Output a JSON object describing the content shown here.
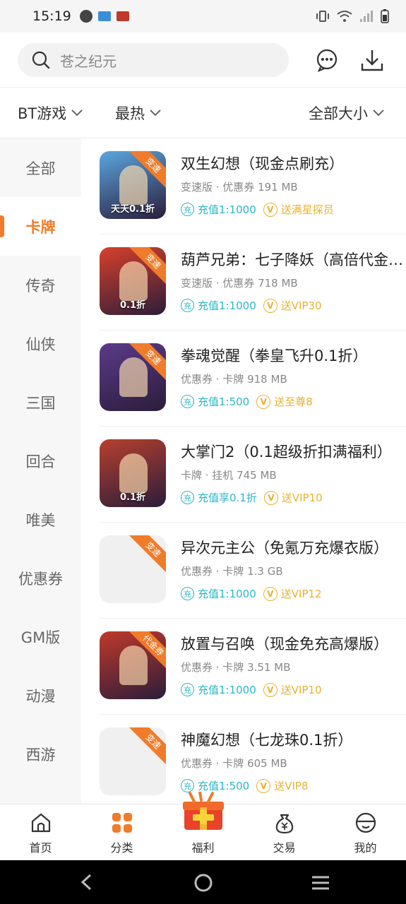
{
  "status_bar": {
    "time": "15:19"
  },
  "search": {
    "placeholder": "苍之纪元"
  },
  "filters": {
    "category": "BT游戏",
    "sort": "最热",
    "size": "全部大小"
  },
  "sidebar": {
    "items": [
      {
        "label": "全部",
        "active": false
      },
      {
        "label": "卡牌",
        "active": true
      },
      {
        "label": "传奇",
        "active": false
      },
      {
        "label": "仙侠",
        "active": false
      },
      {
        "label": "三国",
        "active": false
      },
      {
        "label": "回合",
        "active": false
      },
      {
        "label": "唯美",
        "active": false
      },
      {
        "label": "优惠券",
        "active": false
      },
      {
        "label": "GM版",
        "active": false
      },
      {
        "label": "动漫",
        "active": false
      },
      {
        "label": "西游",
        "active": false
      }
    ]
  },
  "games": [
    {
      "title": "双生幻想（现金点刷充）",
      "meta": "变速版 · 优惠券  191 MB",
      "recharge": "充值1:1000",
      "gift": "送满星探员",
      "ribbon": "变速",
      "thumb": "art",
      "thumb_text": "天天0.1折",
      "thumb_color": "#5aa7e0"
    },
    {
      "title": "葫芦兄弟：七子降妖（高倍代金券版）",
      "meta": "变速版 · 优惠券  718 MB",
      "recharge": "充值1:1000",
      "gift": "送VIP30",
      "ribbon": "变速",
      "thumb": "art",
      "thumb_text": "0.1折",
      "thumb_color": "#d8402b"
    },
    {
      "title": "拳魂觉醒（拳皇飞升0.1折）",
      "meta": "优惠券 · 卡牌  918 MB",
      "recharge": "充值1:500",
      "gift": "送至尊8",
      "ribbon": "变速",
      "thumb": "art",
      "thumb_text": "",
      "thumb_color": "#5b3a8a"
    },
    {
      "title": "大掌门2（0.1超级折扣满福利）",
      "meta": "卡牌 · 挂机  745 MB",
      "recharge": "充值享0.1折",
      "gift": "送VIP10",
      "ribbon": "",
      "thumb": "art",
      "thumb_text": "0.1折",
      "thumb_color": "#b7402e"
    },
    {
      "title": "异次元主公（免氪万充爆衣版）",
      "meta": "优惠券 · 卡牌  1.3 GB",
      "recharge": "充值1:1000",
      "gift": "送VIP12",
      "ribbon": "变速",
      "thumb": "blank",
      "thumb_text": "",
      "thumb_color": "#f0f0f0"
    },
    {
      "title": "放置与召唤（现金免充高爆版）",
      "meta": "优惠券 · 卡牌  3.51 MB",
      "recharge": "充值1:1000",
      "gift": "送VIP10",
      "ribbon": "代金券",
      "thumb": "art",
      "thumb_text": "",
      "thumb_color": "#c0392b"
    },
    {
      "title": "神魔幻想（七龙珠0.1折）",
      "meta": "优惠券 · 卡牌  605 MB",
      "recharge": "充值1:500",
      "gift": "送VIP8",
      "ribbon": "变速",
      "thumb": "blank",
      "thumb_text": "",
      "thumb_color": "#f0f0f0"
    }
  ],
  "tag_icons": {
    "recharge": "充",
    "gift": "V"
  },
  "bottom_nav": {
    "items": [
      {
        "label": "首页",
        "icon": "home-icon"
      },
      {
        "label": "分类",
        "icon": "category-icon",
        "active": true
      },
      {
        "label": "福利",
        "icon": "gift-box-icon"
      },
      {
        "label": "交易",
        "icon": "money-bag-icon"
      },
      {
        "label": "我的",
        "icon": "profile-icon"
      }
    ]
  },
  "colors": {
    "accent": "#f07b2a",
    "teal": "#2bb6c9",
    "gold": "#e8b230"
  }
}
